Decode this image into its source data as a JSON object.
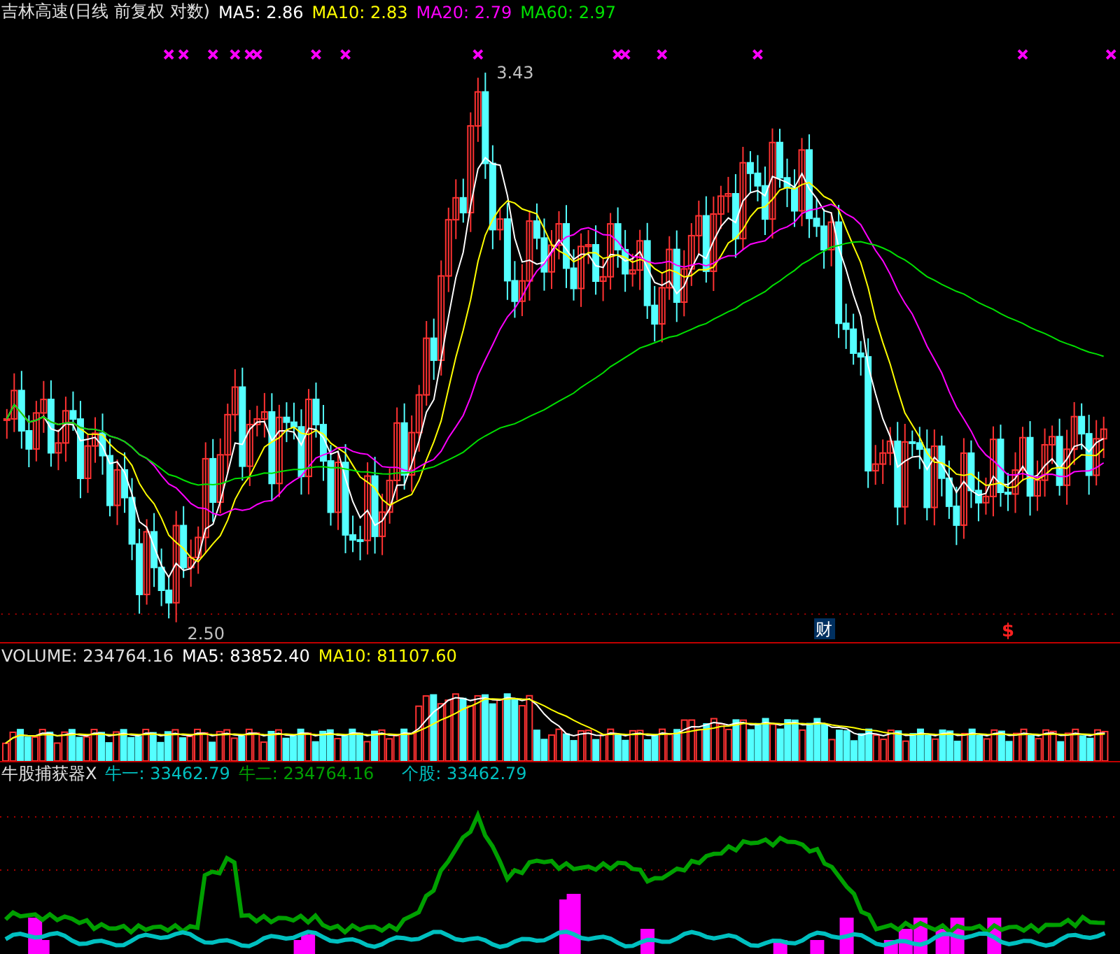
{
  "main": {
    "title": "吉林高速(日线 前复权 对数)",
    "ma": [
      {
        "label": "MA5:",
        "value": "2.86",
        "color": "#ffffff"
      },
      {
        "label": "MA10:",
        "value": "2.83",
        "color": "#ffff00"
      },
      {
        "label": "MA20:",
        "value": "2.79",
        "color": "#ff00ff"
      },
      {
        "label": "MA60:",
        "value": "2.97",
        "color": "#00e000"
      }
    ],
    "high_label": "3.43",
    "low_label": "2.50",
    "markers": [
      {
        "kind": "finance",
        "text": "财"
      },
      {
        "kind": "dividend",
        "text": "$"
      }
    ]
  },
  "volume": {
    "label": "VOLUME:",
    "value": "234764.16",
    "ma": [
      {
        "label": "MA5:",
        "value": "83852.40",
        "color": "#ffffff"
      },
      {
        "label": "MA10:",
        "value": "81107.60",
        "color": "#ffff00"
      }
    ]
  },
  "indicator": {
    "name": "牛股捕获器X",
    "lines": [
      {
        "label": "牛一:",
        "value": "33462.79",
        "color": "#00c0c0"
      },
      {
        "label": "牛二:",
        "value": "234764.16",
        "color": "#00a000"
      },
      {
        "label": "个股:",
        "value": "33462.79",
        "color": "#00c0c0"
      }
    ]
  }
}
